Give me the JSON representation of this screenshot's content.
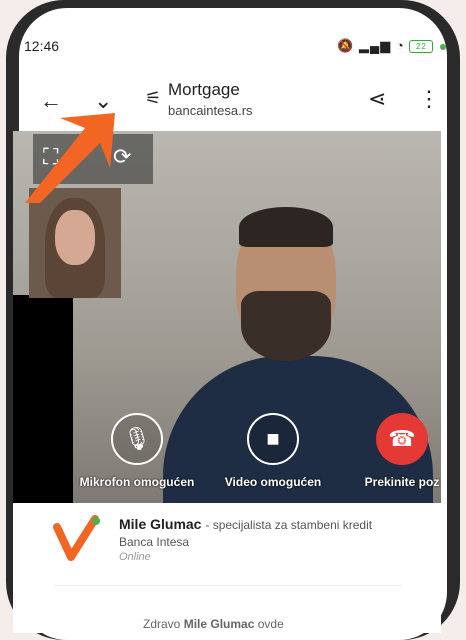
{
  "status": {
    "time": "12:46",
    "battery": "22"
  },
  "app": {
    "title": "Mortgage",
    "domain": "bancaintesa.rs"
  },
  "call": {
    "mic_label": "Mikrofon omogućen",
    "video_label": "Video omogućen",
    "end_label": "Prekinite poz"
  },
  "agent": {
    "name": "Mile Glumac",
    "role": "- specijalista za stambeni kredit",
    "bank": "Banca Intesa",
    "status": "Online"
  },
  "greeting": {
    "prefix": "Zdravo",
    "name": "Mile Glumac",
    "suffix": "ovde"
  },
  "colors": {
    "accent": "#f26522",
    "end_call": "#e53935",
    "online": "#4caf50"
  },
  "icons": [
    "back-arrow-icon",
    "chevron-down-icon",
    "settings-icon",
    "share-icon",
    "more-icon",
    "microphone-icon",
    "video-camera-icon",
    "phone-hangup-icon",
    "switch-camera-icon",
    "pointer-arrow"
  ]
}
